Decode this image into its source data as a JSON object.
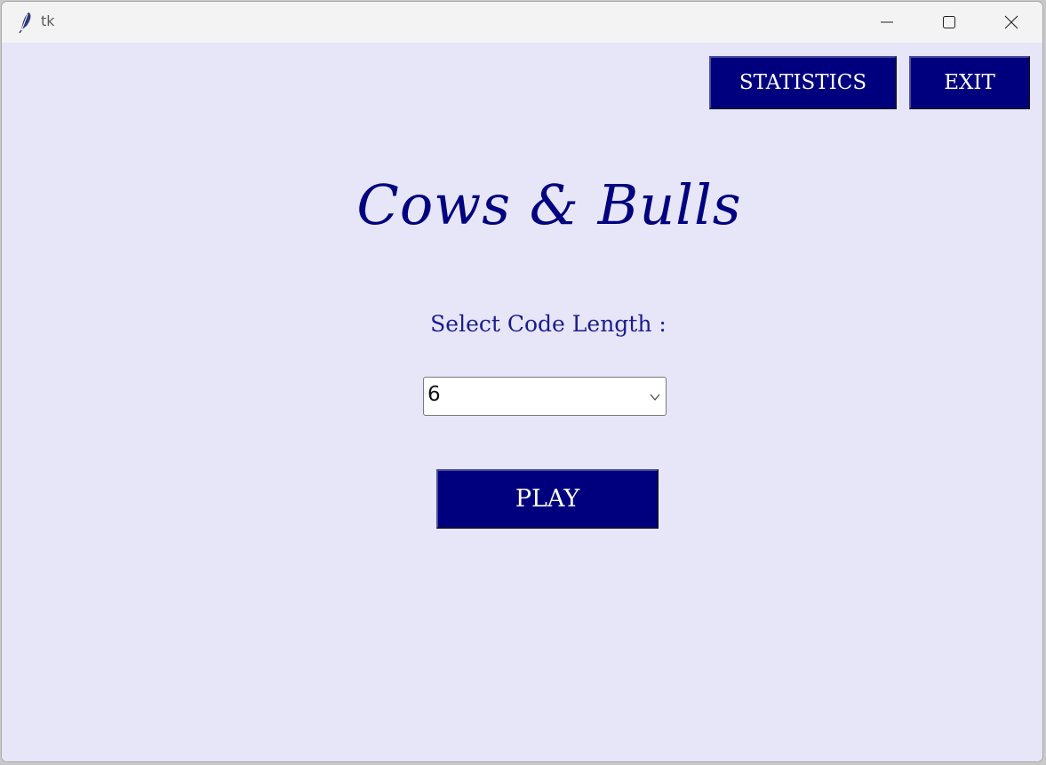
{
  "window": {
    "title": "tk",
    "icons": {
      "app": "feather-icon",
      "minimize": "minimize-icon",
      "maximize": "maximize-icon",
      "close": "close-icon"
    }
  },
  "toolbar": {
    "statistics_label": "STATISTICS",
    "exit_label": "EXIT"
  },
  "main": {
    "title": "Cows & Bulls",
    "prompt": "Select Code Length :",
    "code_length": {
      "selected": "6",
      "dropdown_icon": "chevron-down-icon"
    },
    "play_label": "PLAY"
  },
  "colors": {
    "background": "#e6e6f8",
    "button": "#00007f",
    "button_text": "#ffffff",
    "title_text": "#000080",
    "prompt_text": "#1b1b8f",
    "titlebar": "#f3f3f3"
  }
}
